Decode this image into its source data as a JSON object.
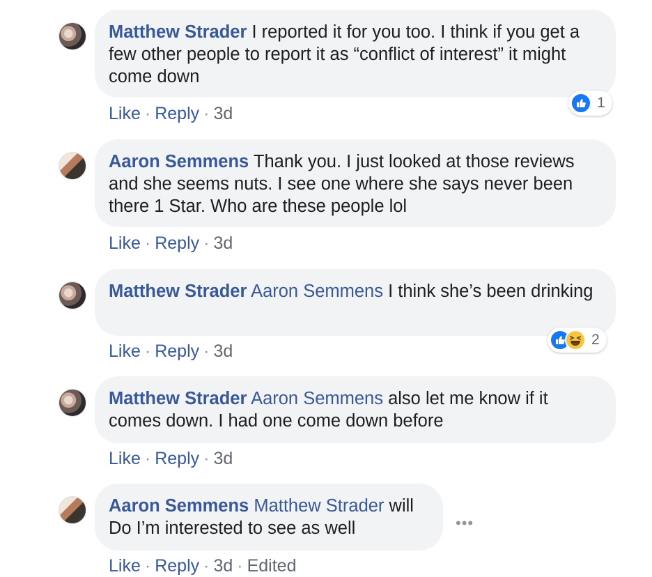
{
  "comments": [
    {
      "author": "Matthew Strader",
      "mention": "",
      "text": "I reported it for you too. I think if you get a few other people to report it as “conflict of interest” it might come down",
      "actions": {
        "like": "Like",
        "reply": "Reply",
        "time": "3d",
        "edited": ""
      },
      "reaction_count": "1"
    },
    {
      "author": "Aaron Semmens",
      "mention": "",
      "text": "Thank you. I just looked at those reviews and she seems nuts. I see one where she says never been there 1 Star. Who are these people lol",
      "actions": {
        "like": "Like",
        "reply": "Reply",
        "time": "3d",
        "edited": ""
      },
      "reaction_count": ""
    },
    {
      "author": "Matthew Strader",
      "mention": "Aaron Semmens",
      "text": "I think she’s been drinking",
      "actions": {
        "like": "Like",
        "reply": "Reply",
        "time": "3d",
        "edited": ""
      },
      "reaction_count": "2"
    },
    {
      "author": "Matthew Strader",
      "mention": "Aaron Semmens",
      "text": "also let me know if it comes down. I had one come down before",
      "actions": {
        "like": "Like",
        "reply": "Reply",
        "time": "3d",
        "edited": ""
      },
      "reaction_count": ""
    },
    {
      "author": "Aaron Semmens",
      "mention": "Matthew Strader",
      "text": "will Do I’m interested to see as well",
      "actions": {
        "like": "Like",
        "reply": "Reply",
        "time": "3d",
        "edited": "Edited"
      },
      "reaction_count": ""
    }
  ],
  "more_options": "•••",
  "icons": {
    "like": "like-reaction-icon",
    "haha": "haha-reaction-icon"
  }
}
